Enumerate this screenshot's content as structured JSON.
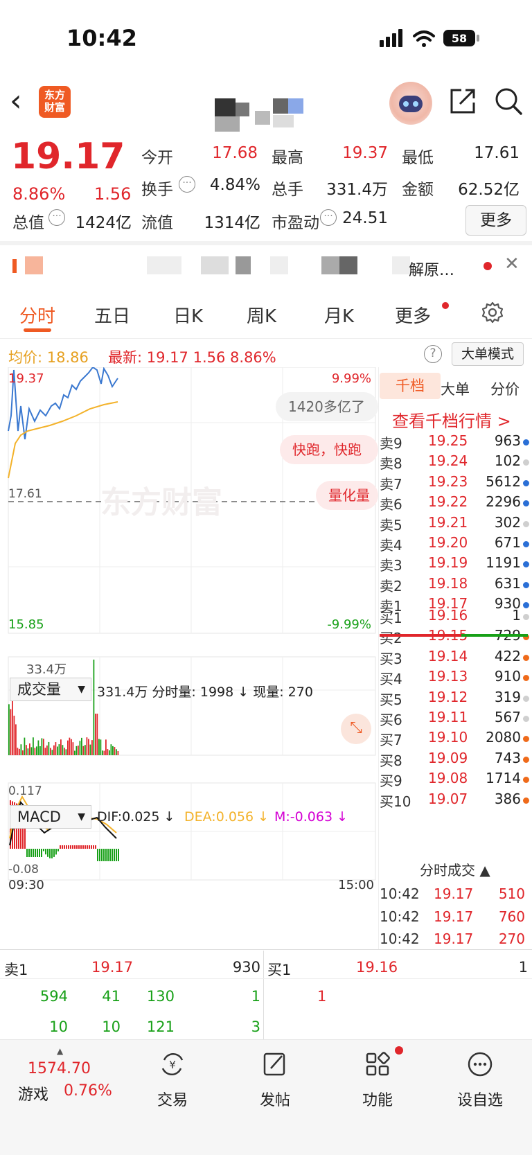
{
  "status": {
    "time": "10:42",
    "battery": "58"
  },
  "header": {
    "logo_text": "东方\n财富"
  },
  "quote": {
    "price": "19.17",
    "change_pct": "8.86%",
    "change_abs": "1.56",
    "rows": [
      [
        {
          "label": "今开",
          "value": "17.68",
          "color": "red"
        },
        {
          "label": "最高",
          "value": "19.37",
          "color": "red"
        },
        {
          "label": "最低",
          "value": "17.61",
          "color": "black"
        }
      ],
      [
        {
          "label": "换手",
          "value": "4.84%",
          "color": "black"
        },
        {
          "label": "总手",
          "value": "331.4万",
          "color": "black"
        },
        {
          "label": "金额",
          "value": "62.52亿",
          "color": "black"
        }
      ]
    ],
    "mkt_value_label": "总值",
    "mkt_value": "1424亿",
    "float_label": "流值",
    "float_value": "1314亿",
    "pe_label": "市盈动",
    "pe_value": "24.51",
    "more_label": "更多"
  },
  "ticker": {
    "text": "解原…"
  },
  "tabs": [
    "分时",
    "五日",
    "日K",
    "周K",
    "月K",
    "更多"
  ],
  "info": {
    "avg_label": "均价:",
    "avg_value": "18.86",
    "latest_label": "最新:",
    "latest_value": "19.17",
    "latest_chg": "1.56",
    "latest_pct": "8.86%",
    "help": "?",
    "bigorder": "大单模式"
  },
  "chart": {
    "y_high": "19.37",
    "y_low": "15.85",
    "y_mid": "17.61",
    "pct_high": "9.99%",
    "pct_low": "-9.99%",
    "watermark": "东方财富",
    "chips": [
      "1420多亿了",
      "快跑，快跑",
      "量化量"
    ],
    "vol_selector": "成交量",
    "vol_info": "331.4万 分时量: 1998 ↓ 现量: 270",
    "vol_total": "331.4万",
    "vol_axis": "33.4万",
    "macd_selector": "MACD",
    "dif": "DIF:0.025 ↓",
    "dea": "DEA:0.056 ↓",
    "m": "M:-0.063 ↓",
    "macd_high": "0.117",
    "macd_low": "-0.08",
    "time_start": "09:30",
    "time_end": "15:00"
  },
  "orderbook": {
    "tabs": [
      "千档",
      "大单",
      "分价"
    ],
    "view_link": "查看千档行情 >",
    "asks": [
      {
        "label": "卖9",
        "price": "19.25",
        "vol": "963",
        "dot": "#2a6fd6"
      },
      {
        "label": "卖8",
        "price": "19.24",
        "vol": "102",
        "dot": "#cfcfcf"
      },
      {
        "label": "卖7",
        "price": "19.23",
        "vol": "5612",
        "dot": "#2a6fd6"
      },
      {
        "label": "卖6",
        "price": "19.22",
        "vol": "2296",
        "dot": "#2a6fd6"
      },
      {
        "label": "卖5",
        "price": "19.21",
        "vol": "302",
        "dot": "#cfcfcf"
      },
      {
        "label": "卖4",
        "price": "19.20",
        "vol": "671",
        "dot": "#2a6fd6"
      },
      {
        "label": "卖3",
        "price": "19.19",
        "vol": "1191",
        "dot": "#2a6fd6"
      },
      {
        "label": "卖2",
        "price": "19.18",
        "vol": "631",
        "dot": "#2a6fd6"
      },
      {
        "label": "卖1",
        "price": "19.17",
        "vol": "930",
        "dot": "#2a6fd6"
      }
    ],
    "bids": [
      {
        "label": "买1",
        "price": "19.16",
        "vol": "1",
        "dot": "#cfcfcf"
      },
      {
        "label": "买2",
        "price": "19.15",
        "vol": "729",
        "dot": "#ef6a1a"
      },
      {
        "label": "买3",
        "price": "19.14",
        "vol": "422",
        "dot": "#ef6a1a"
      },
      {
        "label": "买4",
        "price": "19.13",
        "vol": "910",
        "dot": "#ef6a1a"
      },
      {
        "label": "买5",
        "price": "19.12",
        "vol": "319",
        "dot": "#cfcfcf"
      },
      {
        "label": "买6",
        "price": "19.11",
        "vol": "567",
        "dot": "#cfcfcf"
      },
      {
        "label": "买7",
        "price": "19.10",
        "vol": "2080",
        "dot": "#ef6a1a"
      },
      {
        "label": "买8",
        "price": "19.09",
        "vol": "743",
        "dot": "#ef6a1a"
      },
      {
        "label": "买9",
        "price": "19.08",
        "vol": "1714",
        "dot": "#ef6a1a"
      },
      {
        "label": "买10",
        "price": "19.07",
        "vol": "386",
        "dot": "#ef6a1a"
      }
    ],
    "tick_header": "分时成交 ▲",
    "ticks": [
      {
        "time": "10:42",
        "price": "19.17",
        "vol": "510"
      },
      {
        "time": "10:42",
        "price": "19.17",
        "vol": "760"
      },
      {
        "time": "10:42",
        "price": "19.17",
        "vol": "270"
      }
    ]
  },
  "level1": {
    "sell_label": "卖1",
    "sell_price": "19.17",
    "sell_vol": "930",
    "buy_label": "买1",
    "buy_price": "19.16",
    "buy_vol": "1",
    "sell_queue": [
      [
        "594",
        "41",
        "130",
        "1"
      ],
      [
        "10",
        "10",
        "121",
        "3"
      ]
    ],
    "buy_queue": [
      "1"
    ]
  },
  "bottom_nav": {
    "index_value": "1574.70",
    "index_name": "游戏",
    "index_pct": "0.76%",
    "items": [
      "交易",
      "发帖",
      "功能",
      "设自选"
    ]
  },
  "colors": {
    "up": "#e0262b",
    "down": "#18a018",
    "brand": "#ef5a23",
    "avg_line": "#f3b22a",
    "price_line": "#3a78d0"
  }
}
